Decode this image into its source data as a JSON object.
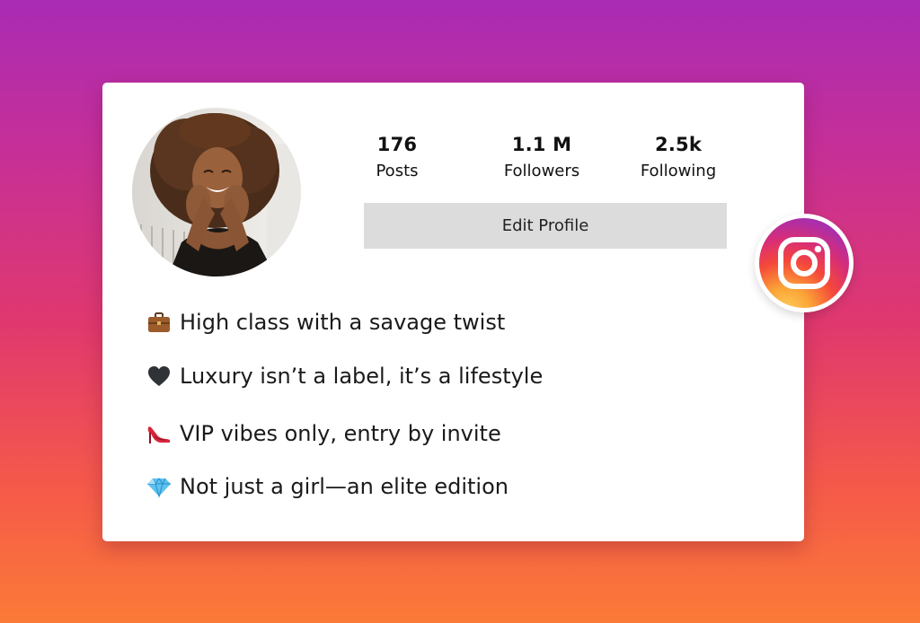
{
  "profile": {
    "stats": [
      {
        "value": "176",
        "label": "Posts"
      },
      {
        "value": "1.1 M",
        "label": "Followers"
      },
      {
        "value": "2.5k",
        "label": "Following"
      }
    ],
    "edit_button_label": "Edit Profile"
  },
  "bio": [
    {
      "icon": "briefcase-icon",
      "text": "High class with a savage twist"
    },
    {
      "icon": "black-heart-icon",
      "text": "Luxury isn’t a label, it’s a lifestyle"
    },
    {
      "icon": "high-heel-icon",
      "text": "VIP vibes only, entry by invite"
    },
    {
      "icon": "gem-icon",
      "text": "Not just a girl—an elite edition"
    }
  ],
  "colors": {
    "background_top": "#a92bb4",
    "background_bottom": "#fb7a37",
    "card": "#ffffff",
    "edit_button": "#dcdcdc"
  },
  "badge": {
    "icon": "instagram-icon"
  }
}
